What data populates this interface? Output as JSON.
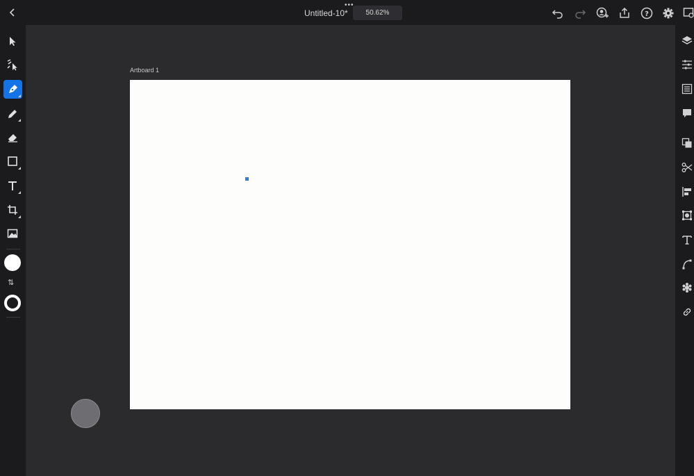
{
  "topbar": {
    "document_title": "Untitled-10*",
    "zoom_level": "50.62%",
    "more_glyph": "•••"
  },
  "left_toolbar": {
    "tools": [
      {
        "name": "select-tool",
        "icon": "pointer-arrow-icon"
      },
      {
        "name": "direct-select-tool",
        "icon": "node-select-icon"
      },
      {
        "name": "pen-tool",
        "icon": "pen-icon",
        "active": true
      },
      {
        "name": "pencil-tool",
        "icon": "pencil-icon"
      },
      {
        "name": "eraser-tool",
        "icon": "eraser-icon"
      },
      {
        "name": "shape-tool",
        "icon": "square-icon"
      },
      {
        "name": "type-tool",
        "icon": "type-icon"
      },
      {
        "name": "crop-tool",
        "icon": "crop-icon"
      },
      {
        "name": "image-tool",
        "icon": "image-icon"
      }
    ],
    "fill_color": "#ffffff",
    "stroke_color": "#ffffff",
    "swap_glyph": "⇅"
  },
  "canvas": {
    "artboard_label": "Artboard 1",
    "artboard_color": "#fdfdfb",
    "anchor_color": "#3a7bd5"
  },
  "right_panel": {
    "icons": [
      "layers-icon",
      "properties-icon",
      "libraries-icon",
      "comments-icon",
      "arrange-icon",
      "cut-icon",
      "align-icon",
      "transform-icon",
      "text-properties-icon",
      "path-icon",
      "effects-icon",
      "link-icon"
    ]
  },
  "colors": {
    "accent": "#1473e6",
    "chrome": "#1b1a1d",
    "canvas_bg": "#2b2a2d"
  }
}
